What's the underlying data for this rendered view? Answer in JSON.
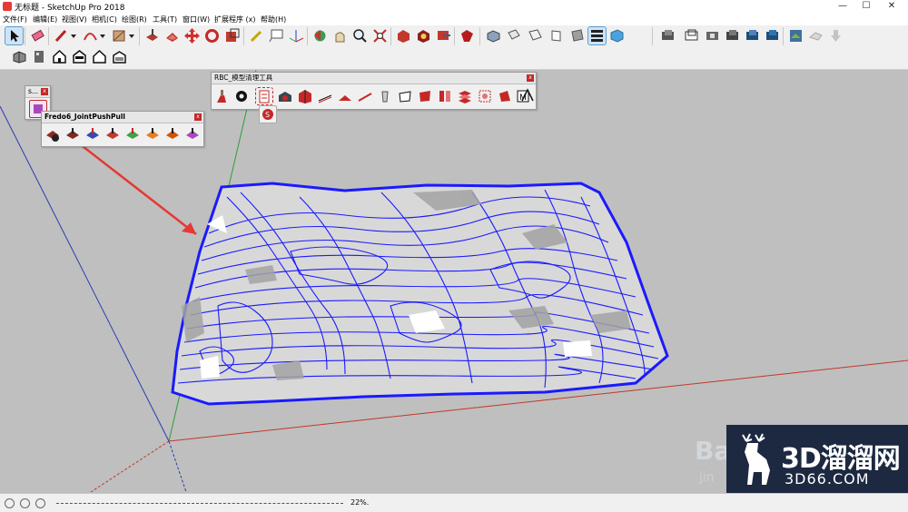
{
  "app": {
    "title": "无标题 - SketchUp Pro 2018",
    "window_controls": [
      "—",
      "☐",
      "✕"
    ]
  },
  "menu": [
    "文件(F)",
    "编辑(E)",
    "视图(V)",
    "相机(C)",
    "绘图(R)",
    "工具(T)",
    "窗口(W)",
    "扩展程序 (x)",
    "帮助(H)"
  ],
  "panels": {
    "small": {
      "title": "s..."
    },
    "fredo": {
      "title": "Fredo6_JointPushPull"
    },
    "rbc": {
      "title": "RBC_模型清理工具"
    }
  },
  "status": {
    "zoom": "22%."
  },
  "watermark": {
    "text_main": "3D溜溜网",
    "text_sub": "3D66.COM",
    "bai_main": "Bai",
    "bai_sub": "jin"
  },
  "colors": {
    "contour": "#1a1aff",
    "arrow": "#e53935",
    "axis_red": "#c0392b",
    "axis_green": "#2e9d3a",
    "axis_blue": "#2a3ab5"
  }
}
